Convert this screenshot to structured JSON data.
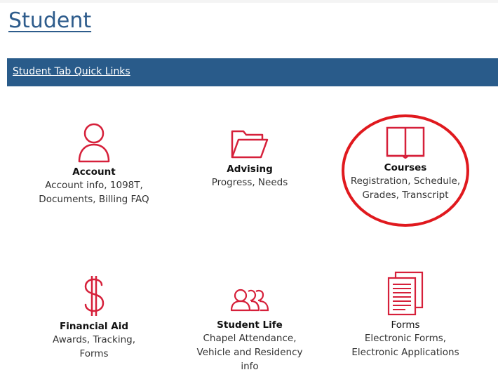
{
  "page": {
    "title": "Student"
  },
  "quick_links": {
    "label": "Student Tab Quick Links"
  },
  "tiles": [
    {
      "title": "Account",
      "desc_lines": [
        "Account info, 1098T,",
        "Documents, Billing FAQ"
      ],
      "icon": "person-icon"
    },
    {
      "title": "Advising",
      "desc_lines": [
        "Progress, Needs"
      ],
      "icon": "folder-icon"
    },
    {
      "title": "Courses",
      "desc_lines": [
        "Registration, Schedule,",
        "Grades, Transcript"
      ],
      "icon": "book-icon"
    },
    {
      "title": "Financial Aid",
      "desc_lines": [
        "Awards, Tracking,",
        "Forms"
      ],
      "icon": "dollar-icon"
    },
    {
      "title": "Student Life",
      "desc_lines": [
        "Chapel Attendance,",
        "Vehicle and Residency",
        "info"
      ],
      "icon": "group-icon"
    },
    {
      "title": "Forms",
      "desc_lines": [
        "Electronic Forms,",
        "Electronic Applications"
      ],
      "icon": "document-icon"
    }
  ],
  "colors": {
    "accent": "#d6203a",
    "bar": "#295b8a",
    "title": "#2e5c8c",
    "annotation": "#e0191e"
  }
}
